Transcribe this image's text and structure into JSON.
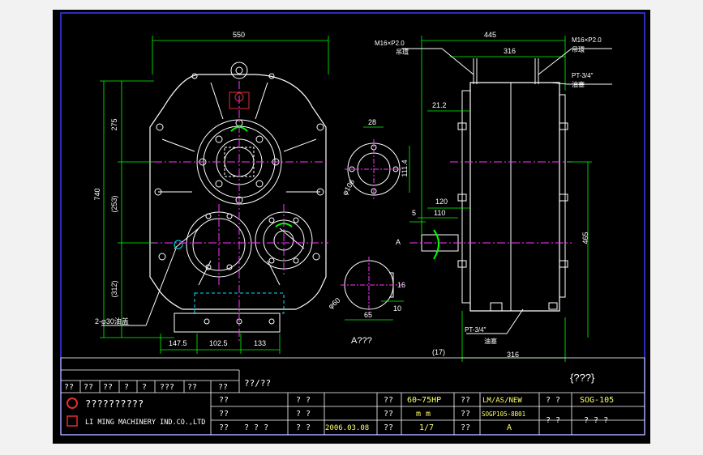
{
  "colors": {
    "background": "#000000",
    "border": "#3b3bff",
    "outline": "#ffffff",
    "dimension": "#00ff00",
    "centerline": "#ff33ff",
    "hidden": "#00e5ff",
    "leader": "#ffffff",
    "logo": "#e03030",
    "title_text": "#ffff66"
  },
  "dimensions": {
    "overall_width": "550",
    "depth_445": "445",
    "depth_316_top": "316",
    "bolt_m16_left": "M16×P2.0",
    "bolt_m16_left_note": "吊環",
    "bolt_m16_right": "M16×P2.0",
    "bolt_m16_right_note": "吊環",
    "plug_pt34_top": "PT-3/4\"",
    "plug_pt34_top_note": "油塞",
    "d275": "275",
    "d740": "740",
    "d253": "(253)",
    "d312": "(312)",
    "d21_2": "21.2",
    "d28": "28",
    "d111_4": "111.4",
    "d106": "φ106",
    "d120": "120",
    "d110": "110",
    "d5": "5",
    "label_a": "A",
    "d465": "465",
    "d16": "16",
    "d60": "φ60",
    "d10": "10",
    "d65": "65",
    "holes": "2-φ30油盖",
    "d147_5": "147.5",
    "d102_5": "102.5",
    "d133": "133",
    "view_a": "A???",
    "plug_pt34_bottom": "PT-3/4\"",
    "plug_pt34_bottom_note": "油塞",
    "d17": "(17)",
    "depth_316_bottom": "316",
    "corner_note": "{???}"
  },
  "title_block": {
    "rev_cells": [
      "??",
      "??",
      "??",
      "?",
      "?",
      "???",
      "??",
      "??"
    ],
    "part_label": "??/??",
    "company_name_cn": "??????????",
    "company_name_en": "LI MING MACHINERY IND.CO.,LTD",
    "r1": [
      "??",
      "? ?",
      "??",
      "60~75HP",
      "??",
      "LM/AS/NEW",
      "? ?",
      "SOG-105"
    ],
    "r2": [
      "??",
      "? ?",
      "??",
      "m m",
      "??",
      "SOGP105-8B01",
      "? ?",
      "? ? ?"
    ],
    "r3": [
      "??",
      "? ? ?",
      "? ?",
      "2006.03.08",
      "??",
      "1/7",
      "??",
      "A"
    ]
  }
}
